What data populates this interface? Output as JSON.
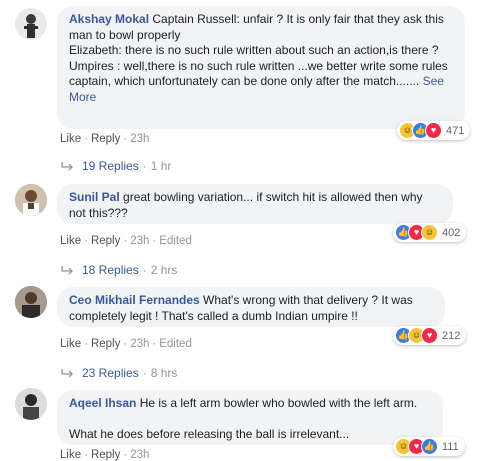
{
  "comments": [
    {
      "author": "Akshay Mokal",
      "text": "Captain Russell: unfair ? It is only fair that they ask this man to bowl properly\nElizabeth: there is no such rule written about such an action,is there ?\nUmpires : well,there is no such rule written ...we better write some rules captain, which unfortunately can be done only after the match.......",
      "see_more": "See More",
      "reaction_count": "471",
      "like": "Like",
      "reply": "Reply",
      "time": "23h",
      "edited": "",
      "replies_label": "19 Replies",
      "replies_time": "1 hr"
    },
    {
      "author": "Sunil Pal",
      "text": "great bowling variation... if switch hit is allowed then why not this???",
      "see_more": "",
      "reaction_count": "402",
      "like": "Like",
      "reply": "Reply",
      "time": "23h",
      "edited": "Edited",
      "replies_label": "18 Replies",
      "replies_time": "2 hrs"
    },
    {
      "author": "Ceo Mikhail Fernandes",
      "text": "What's wrong with that delivery ? It was completely legit ! That's called a dumb Indian umpire !!",
      "see_more": "",
      "reaction_count": "212",
      "like": "Like",
      "reply": "Reply",
      "time": "23h",
      "edited": "Edited",
      "replies_label": "23 Replies",
      "replies_time": "8 hrs"
    },
    {
      "author": "Aqeel Ihsan",
      "text": "He is a left arm bowler who bowled with the left arm.\n\nWhat he does before releasing the ball is irrelevant...",
      "see_more": "",
      "reaction_count": "111",
      "like": "Like",
      "reply": "Reply",
      "time": "23h",
      "edited": "",
      "replies_label": "",
      "replies_time": ""
    }
  ],
  "icons": {
    "like": "like-reaction-icon",
    "haha": "haha-reaction-icon",
    "love": "love-reaction-icon",
    "reply_arrow": "reply-arrow-icon"
  },
  "colors": {
    "author": "#385898",
    "bubble": "#f2f3f5",
    "meta": "#90949c",
    "like": "#3a7bf0",
    "haha": "#f7c431",
    "love": "#f0284a"
  }
}
